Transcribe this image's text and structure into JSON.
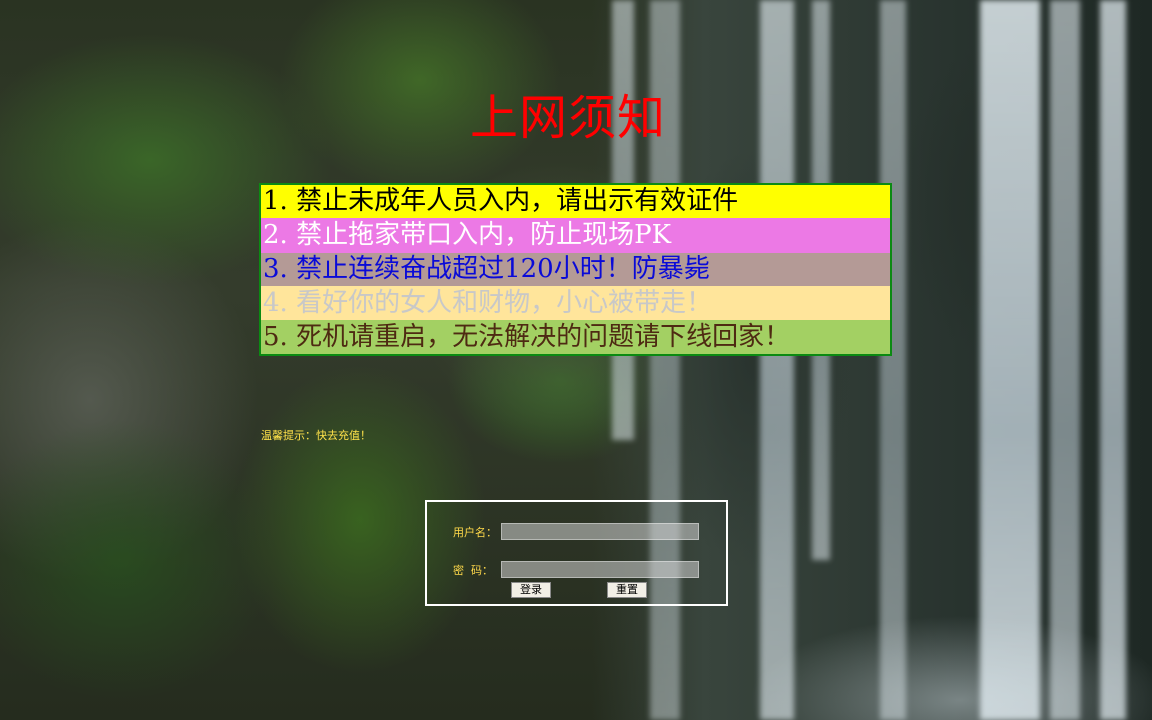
{
  "page": {
    "title": "上网须知"
  },
  "rules": [
    {
      "text": "1. 禁止未成年人员入内，请出示有效证件",
      "bg": "#ffff00",
      "color": "#000000"
    },
    {
      "text": "2. 禁止拖家带口入内，防止现场PK",
      "bg": "#ec79e5",
      "color": "#ffffff"
    },
    {
      "text": "3. 禁止连续奋战超过120小时！防暴毙",
      "bg": "#b49a96",
      "color": "#0a0ad8"
    },
    {
      "text": "4. 看好你的女人和财物，小心被带走！",
      "bg": "#ffe59b",
      "color": "#c8c8c8"
    },
    {
      "text": "5. 死机请重启，无法解决的问题请下线回家！",
      "bg": "#a3d063",
      "color": "#4e2a12"
    }
  ],
  "tip": {
    "text": "温馨提示：快去充值！"
  },
  "login": {
    "username_label": "用户名：",
    "password_label": "密  码：",
    "username_value": "",
    "password_value": "",
    "login_button": "登录",
    "reset_button": "重置"
  },
  "colors": {
    "title": "#ff0000",
    "rules_border": "#0b8a12",
    "tip_text": "#ffe24a",
    "login_border": "#ffffff",
    "login_labels": "#ffd94a"
  }
}
